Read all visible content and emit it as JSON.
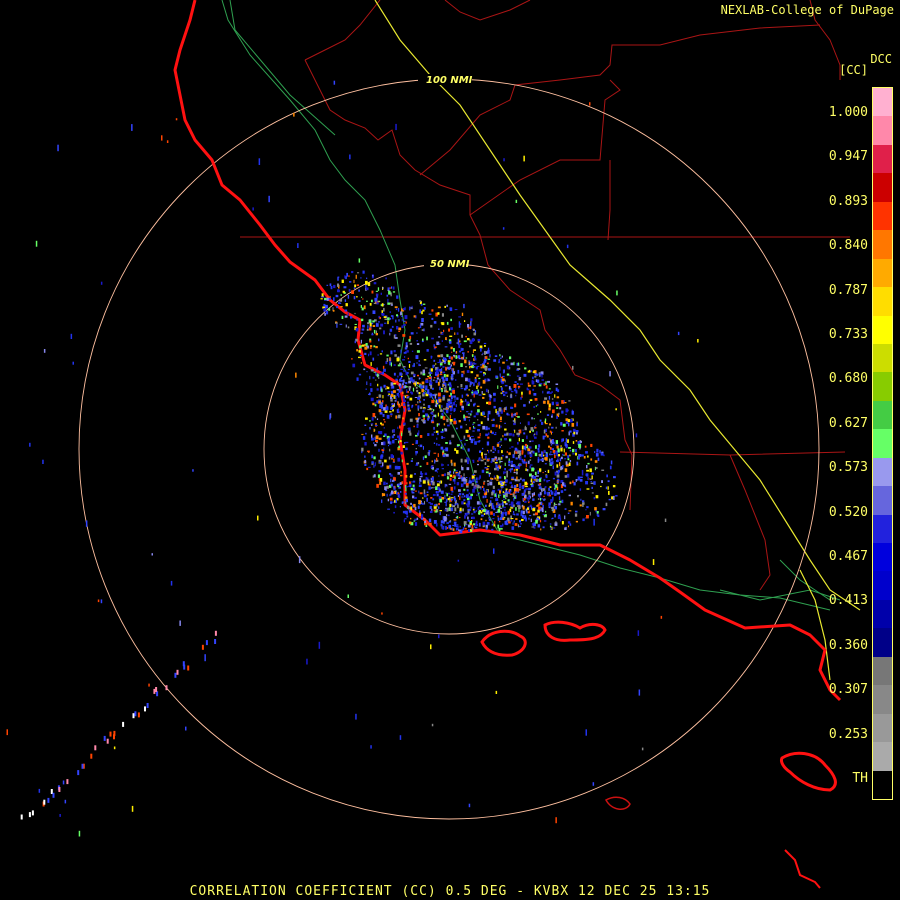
{
  "header": {
    "credit": "NEXLAB-College of DuPage",
    "product_code": "DCC",
    "product_unit": "[CC]"
  },
  "range_rings": {
    "outer_label": "100 NMI",
    "inner_label": "50 NMI"
  },
  "colorbar": {
    "labels": [
      "1.000",
      "0.947",
      "0.893",
      "0.840",
      "0.787",
      "0.733",
      "0.680",
      "0.627",
      "0.573",
      "0.520",
      "0.467",
      "0.413",
      "0.360",
      "0.307",
      "0.253",
      "TH"
    ],
    "colors": [
      "#ffb0d0",
      "#ff88aa",
      "#e0204a",
      "#cc0000",
      "#ff3300",
      "#ff7700",
      "#ffaa00",
      "#ffdd00",
      "#ffff00",
      "#ccdd00",
      "#88cc00",
      "#44cc44",
      "#66ff66",
      "#9999ee",
      "#6666dd",
      "#2222dd",
      "#0000dd",
      "#0000cc",
      "#0000aa",
      "#000088",
      "#777777",
      "#888888",
      "#999999",
      "#aaaaaa",
      "#000000"
    ]
  },
  "caption": "CORRELATION COEFFICIENT (CC) 0.5 DEG - KVBX 12 DEC 25 13:15",
  "colors": {
    "coastline": "#ff1111",
    "borders": "#bb1111",
    "roads": "#33aa55",
    "highway": "#ffff44",
    "rings": "#ffc0a0",
    "text": "#ffff66"
  }
}
